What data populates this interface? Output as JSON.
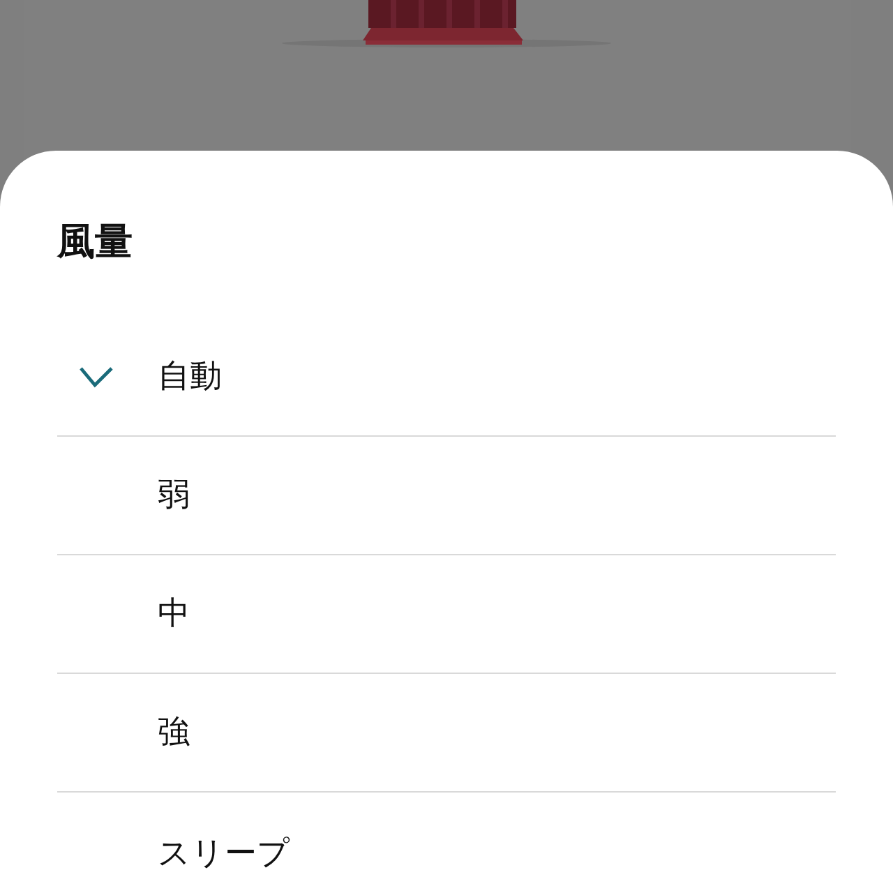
{
  "sheet": {
    "title": "風量",
    "options": [
      {
        "label": "自動",
        "selected": true
      },
      {
        "label": "弱",
        "selected": false
      },
      {
        "label": "中",
        "selected": false
      },
      {
        "label": "強",
        "selected": false
      },
      {
        "label": "スリープ",
        "selected": false
      }
    ]
  }
}
